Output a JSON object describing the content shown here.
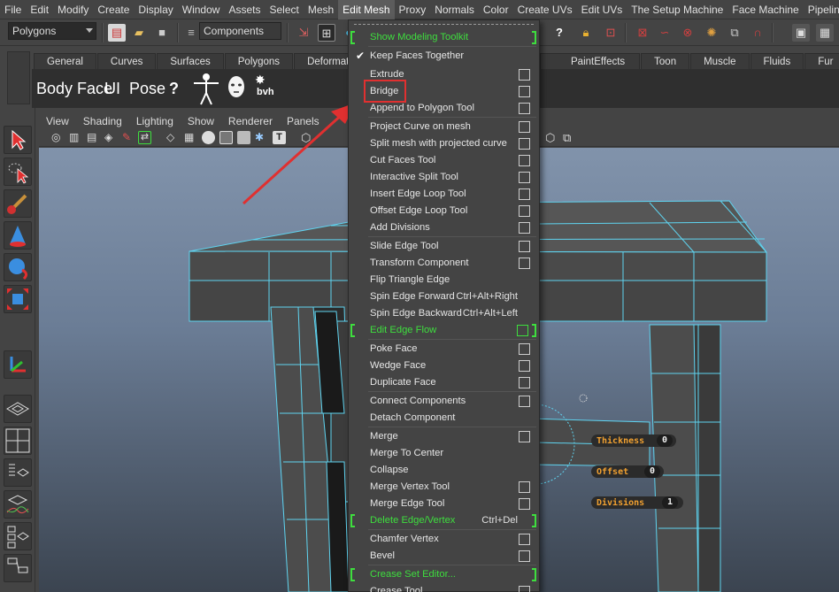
{
  "menubar": {
    "items": [
      "File",
      "Edit",
      "Modify",
      "Create",
      "Display",
      "Window",
      "Assets",
      "Select",
      "Mesh",
      "Edit Mesh",
      "Proxy",
      "Normals",
      "Color",
      "Create UVs",
      "Edit UVs",
      "The Setup Machine",
      "Face Machine",
      "Pipeline Ca"
    ],
    "active": "Edit Mesh"
  },
  "statusline": {
    "mode_selector": "Polygons",
    "selection_mode": "Components"
  },
  "shelf": {
    "tabs": [
      "General",
      "Curves",
      "Surfaces",
      "Polygons",
      "Deformation",
      "PaintEffects",
      "Toon",
      "Muscle",
      "Fluids",
      "Fur"
    ],
    "buttons": {
      "body_face": "Body Face",
      "ui": "UI",
      "pose": "Pose",
      "help": "?",
      "bvh": "bvh"
    }
  },
  "viewport_menu": [
    "View",
    "Shading",
    "Lighting",
    "Show",
    "Renderer",
    "Panels"
  ],
  "edit_mesh_menu": {
    "items": [
      {
        "label": "Show Modeling Toolkit",
        "green": true,
        "bracket": true
      },
      {
        "label": "Keep Faces Together",
        "checked": true
      },
      {
        "label": "Extrude",
        "option": true
      },
      {
        "label": "Bridge",
        "option": true
      },
      {
        "label": "Append to Polygon Tool",
        "option": true
      },
      {
        "label": "Project Curve on mesh",
        "option": true
      },
      {
        "label": "Split mesh with projected curve",
        "option": true
      },
      {
        "label": "Cut Faces Tool",
        "option": true
      },
      {
        "label": "Interactive Split Tool",
        "option": true
      },
      {
        "label": "Insert Edge Loop Tool",
        "option": true
      },
      {
        "label": "Offset Edge Loop Tool",
        "option": true
      },
      {
        "label": "Add Divisions",
        "option": true
      },
      {
        "label": "Slide Edge Tool",
        "option": true
      },
      {
        "label": "Transform Component",
        "option": true
      },
      {
        "label": "Flip Triangle Edge"
      },
      {
        "label": "Spin Edge Forward",
        "shortcut": "Ctrl+Alt+Right"
      },
      {
        "label": "Spin Edge Backward",
        "shortcut": "Ctrl+Alt+Left"
      },
      {
        "label": "Edit Edge Flow",
        "green": true,
        "bracket": true,
        "option": true
      },
      {
        "label": "Poke Face",
        "option": true
      },
      {
        "label": "Wedge Face",
        "option": true
      },
      {
        "label": "Duplicate Face",
        "option": true
      },
      {
        "label": "Connect Components",
        "option": true
      },
      {
        "label": "Detach Component"
      },
      {
        "label": "Merge",
        "option": true
      },
      {
        "label": "Merge To Center"
      },
      {
        "label": "Collapse"
      },
      {
        "label": "Merge Vertex Tool",
        "option": true
      },
      {
        "label": "Merge Edge Tool",
        "option": true
      },
      {
        "label": "Delete Edge/Vertex",
        "green": true,
        "bracket": true,
        "shortcut": "Ctrl+Del"
      },
      {
        "label": "Chamfer Vertex",
        "option": true
      },
      {
        "label": "Bevel",
        "option": true
      },
      {
        "label": "Crease Set Editor...",
        "green": true,
        "bracket": true
      },
      {
        "label": "Crease Tool",
        "option": true
      }
    ]
  },
  "hud": {
    "thickness_label": "Thickness",
    "thickness_value": "0",
    "offset_label": "Offset",
    "offset_value": "0",
    "divisions_label": "Divisions",
    "divisions_value": "1"
  },
  "colors": {
    "accent_green": "#3ede3e",
    "highlight_red": "#e03030",
    "wire_cyan": "#5fd4f0",
    "hud_orange": "#f0a030"
  }
}
